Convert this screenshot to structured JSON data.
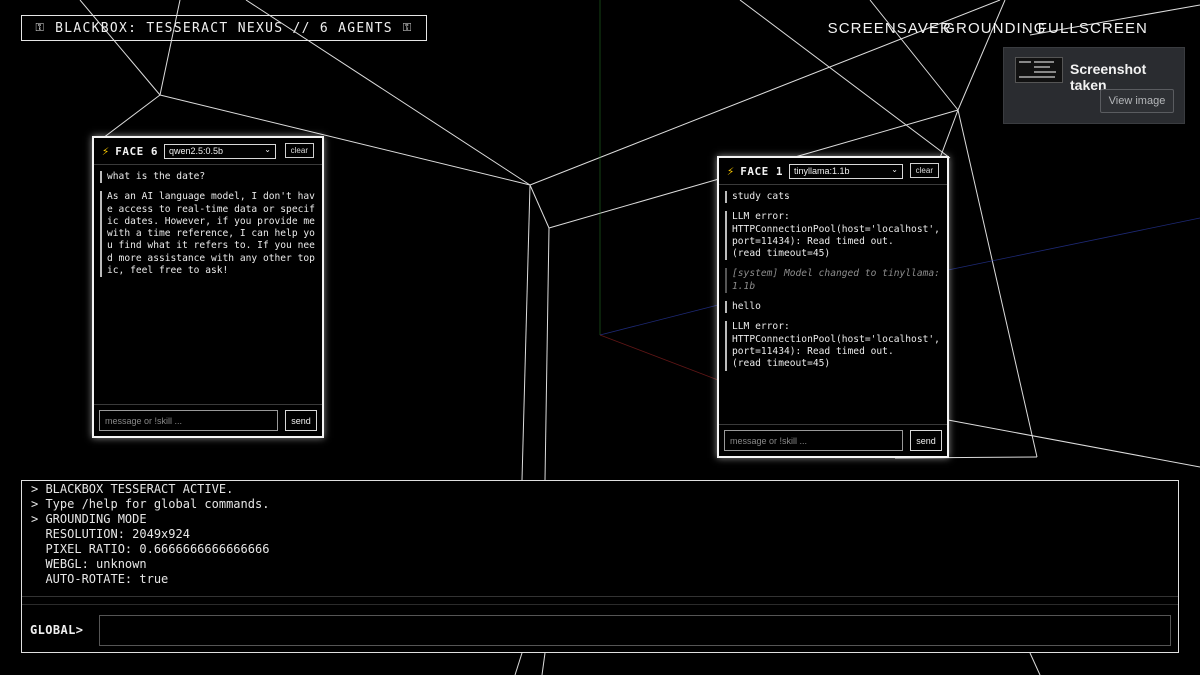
{
  "header": {
    "title": "BLACKBOX: TESSERACT NEXUS // 6 AGENTS",
    "key_glyph": "⚿"
  },
  "top_links": {
    "screensaver": "SCREENSAVER",
    "grounding": "GROUNDING",
    "fullscreen": "FULLSCREEN"
  },
  "toast": {
    "title": "Screenshot taken",
    "view_button": "View image"
  },
  "faces": [
    {
      "name": "FACE 6",
      "model": "qwen2.5:0.5b",
      "clear_label": "clear",
      "messages": [
        {
          "kind": "user",
          "text": "what is the date?"
        },
        {
          "kind": "assistant",
          "text": "As an AI language model, I don't have access to real-time data or specific dates. However, if you provide me with a time reference, I can help you find what it refers to. If you need more assistance with any other topic, feel free to ask!"
        }
      ],
      "input_placeholder": "message or !skill ...",
      "send_label": "send"
    },
    {
      "name": "FACE 1",
      "model": "tinyllama:1.1b",
      "clear_label": "clear",
      "messages": [
        {
          "kind": "user",
          "text": "study cats"
        },
        {
          "kind": "assistant",
          "text": "LLM error:\nHTTPConnectionPool(host='localhost', port=11434): Read timed out.\n(read timeout=45)"
        },
        {
          "kind": "system",
          "text": "[system] Model changed to tinyllama:1.1b"
        },
        {
          "kind": "user",
          "text": "hello"
        },
        {
          "kind": "assistant",
          "text": "LLM error:\nHTTPConnectionPool(host='localhost', port=11434): Read timed out.\n(read timeout=45)"
        }
      ],
      "input_placeholder": "message or !skill ...",
      "send_label": "send"
    }
  ],
  "console": {
    "lines": [
      "> BLACKBOX TESSERACT ACTIVE.",
      "> Type /help for global commands.",
      "> GROUNDING MODE",
      "  RESOLUTION: 2049x924",
      "  PIXEL RATIO: 0.6666666666666666",
      "  WEBGL: unknown",
      "  AUTO-ROTATE: true"
    ],
    "prompt": "GLOBAL>",
    "input_value": ""
  },
  "colors": {
    "background": "#000000",
    "wire": "#d9d9d9",
    "bolt": "#f5c400",
    "toast_bg": "#2a2c30"
  }
}
